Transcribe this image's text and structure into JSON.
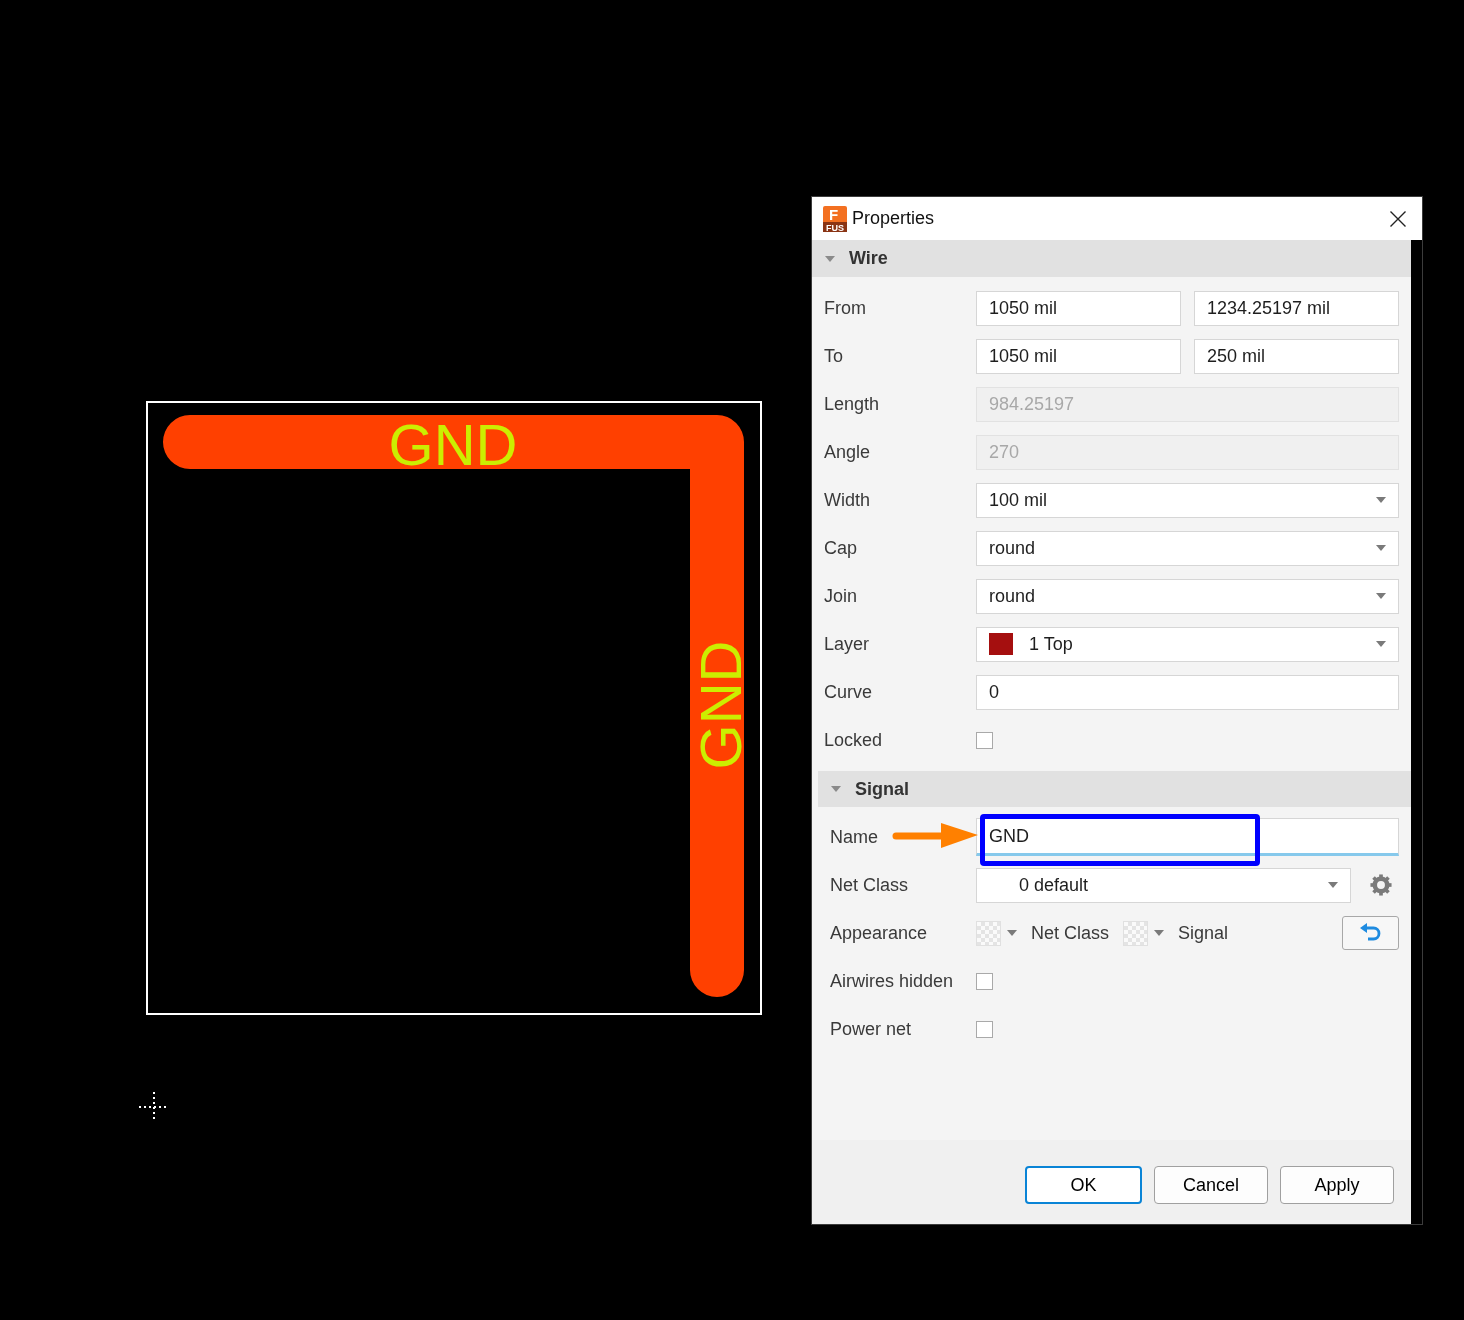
{
  "canvas": {
    "wire": {
      "segments": [
        {
          "label": "GND"
        },
        {
          "label": "GND"
        }
      ]
    }
  },
  "dialog": {
    "title": "Properties",
    "logo": {
      "letter": "F",
      "caption": "FUS"
    },
    "sections": [
      {
        "title": "Wire",
        "expanded": true,
        "rows": [
          {
            "kind": "pair",
            "label": "From",
            "values": [
              "1050 mil",
              "1234.25197 mil"
            ]
          },
          {
            "kind": "pair",
            "label": "To",
            "values": [
              "1050 mil",
              "250 mil"
            ]
          },
          {
            "kind": "text",
            "label": "Length",
            "value": "984.25197",
            "disabled": true,
            "focused": false
          },
          {
            "kind": "text",
            "label": "Angle",
            "value": "270",
            "disabled": true,
            "focused": false
          },
          {
            "kind": "dropdown",
            "label": "Width",
            "value": "100 mil"
          },
          {
            "kind": "dropdown",
            "label": "Cap",
            "value": "round"
          },
          {
            "kind": "dropdown",
            "label": "Join",
            "value": "round"
          },
          {
            "kind": "layer",
            "label": "Layer",
            "value": "1 Top",
            "color": "#a50f0f"
          },
          {
            "kind": "text",
            "label": "Curve",
            "value": "0",
            "disabled": false,
            "focused": false
          },
          {
            "kind": "checkbox",
            "label": "Locked",
            "checked": false
          }
        ]
      },
      {
        "title": "Signal",
        "expanded": true,
        "rows": [
          {
            "kind": "text",
            "label": "Name",
            "value": "GND",
            "disabled": false,
            "focused": true,
            "highlighted": true
          },
          {
            "kind": "netclass",
            "label": "Net Class",
            "value": "0 default"
          },
          {
            "kind": "appearance",
            "label": "Appearance",
            "options": [
              {
                "label": "Net Class"
              },
              {
                "label": "Signal"
              }
            ]
          },
          {
            "kind": "checkbox",
            "label": "Airwires hidden",
            "checked": false
          },
          {
            "kind": "checkbox",
            "label": "Power net",
            "checked": false
          }
        ]
      }
    ],
    "buttons": [
      {
        "label": "OK",
        "default": true
      },
      {
        "label": "Cancel",
        "default": false
      },
      {
        "label": "Apply",
        "default": false
      }
    ]
  }
}
